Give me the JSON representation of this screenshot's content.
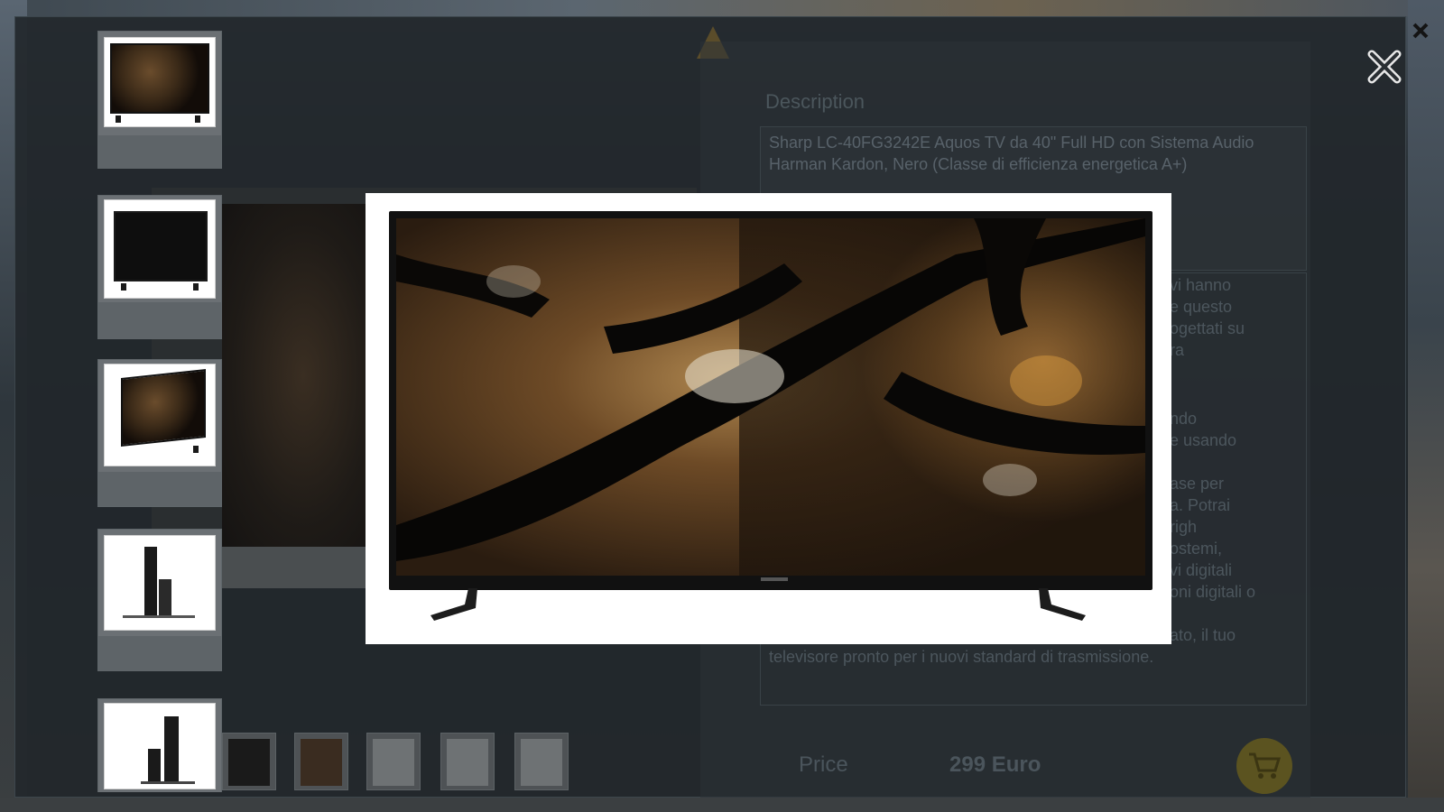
{
  "panel": {
    "description_heading": "Description",
    "description_text": "Sharp LC-40FG3242E Aquos TV da 40\" Full HD con Sistema Audio Harman Kardon, Nero (Classe di efficienza energetica A+)",
    "ghost_lines": [
      "vi hanno",
      "e questo",
      "ogettati su",
      "ra",
      "ndo",
      "e usando",
      "ase per",
      "a. Potrai",
      "righ",
      "ostemi,",
      "vi digitali",
      "oni digitali o",
      "ato, il tuo"
    ],
    "description_last_line": "televisore pronto per i nuovi standard di trasmissione.",
    "price_label": "Price",
    "price_value": "299 Euro"
  },
  "icons": {
    "close": "close-x-icon",
    "cart": "shopping-cart-icon"
  },
  "colors": {
    "accent_cart": "#5b5320",
    "panel_bg": "#22282c"
  }
}
